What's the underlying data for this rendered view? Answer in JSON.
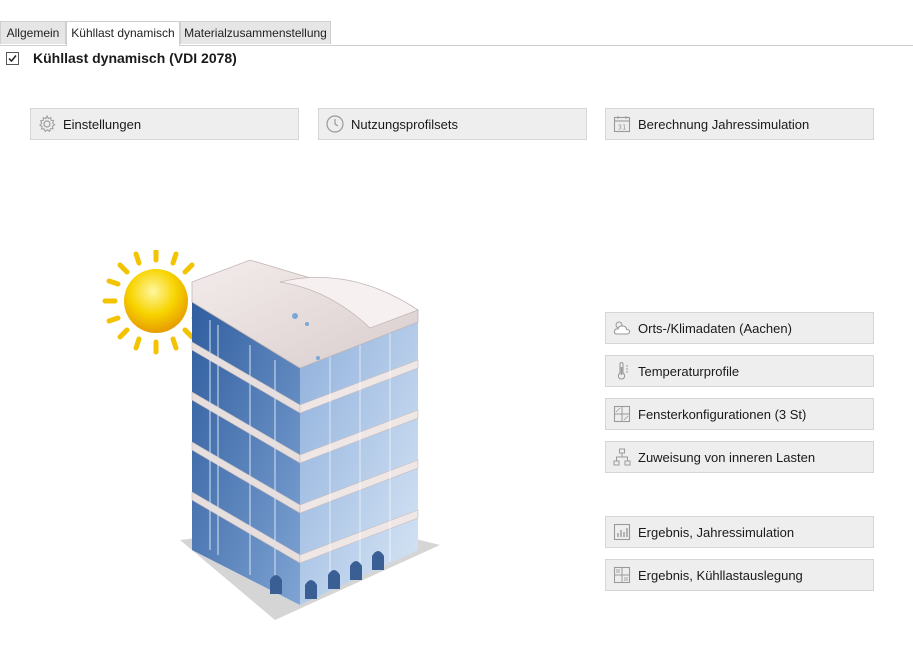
{
  "tabs": [
    {
      "label": "Allgemein",
      "active": false
    },
    {
      "label": "Kühllast dynamisch",
      "active": true
    },
    {
      "label": "Materialzusammenstellung",
      "active": false
    }
  ],
  "section": {
    "title": "Kühllast dynamisch (VDI 2078)",
    "checked": true
  },
  "top_buttons": {
    "settings": {
      "label": "Einstellungen",
      "icon": "gear-icon"
    },
    "profiles": {
      "label": "Nutzungsprofilsets",
      "icon": "clock-icon"
    },
    "annual": {
      "label": "Berechnung Jahressimulation",
      "icon": "calendar-icon"
    }
  },
  "side_buttons": {
    "climate": {
      "label": "Orts-/Klimadaten (Aachen)",
      "icon": "weather-cloud-icon"
    },
    "temperature": {
      "label": "Temperaturprofile",
      "icon": "thermometer-icon"
    },
    "windows": {
      "label": "Fensterkonfigurationen (3 St)",
      "icon": "window-grid-icon"
    },
    "loads": {
      "label": "Zuweisung von inneren Lasten",
      "icon": "hierarchy-icon"
    },
    "result_annual": {
      "label": "Ergebnis, Jahressimulation",
      "icon": "bar-chart-icon"
    },
    "result_cooling": {
      "label": "Ergebnis, Kühllastauslegung",
      "icon": "table-icon"
    }
  },
  "colors": {
    "button_bg": "#eeeeee",
    "icon_gray": "#9a9a9a",
    "sun": "#f7c800",
    "glass": "#3f6fb0"
  }
}
